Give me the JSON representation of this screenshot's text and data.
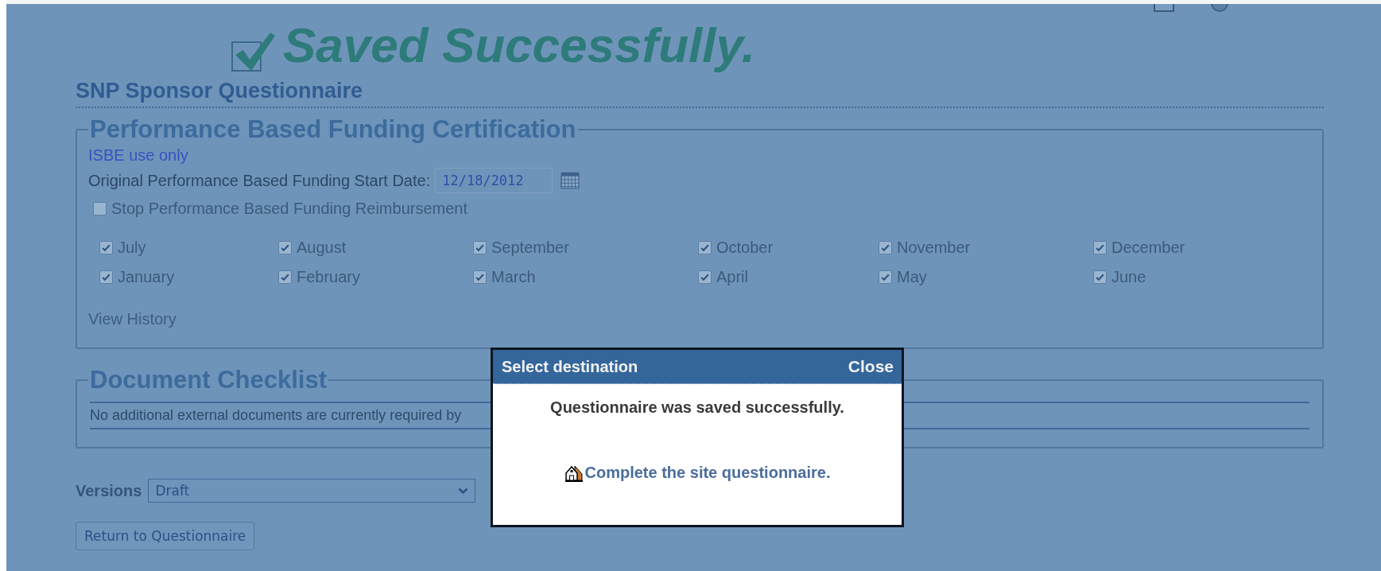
{
  "banner": {
    "text": "Saved Successfully."
  },
  "page_title": "SNP Sponsor Questionnaire",
  "certification": {
    "legend": "Performance Based Funding Certification",
    "note": "ISBE use only",
    "start_date": {
      "label": "Original Performance Based Funding Start Date:",
      "value": "12/18/2012"
    },
    "stop": {
      "label": "Stop Performance Based Funding Reimbursement",
      "checked": false,
      "disabled": true
    },
    "months": [
      {
        "label": "July",
        "checked": true,
        "disabled": true
      },
      {
        "label": "August",
        "checked": true,
        "disabled": true
      },
      {
        "label": "September",
        "checked": true,
        "disabled": true
      },
      {
        "label": "October",
        "checked": true,
        "disabled": true
      },
      {
        "label": "November",
        "checked": true,
        "disabled": true
      },
      {
        "label": "December",
        "checked": true,
        "disabled": true
      },
      {
        "label": "January",
        "checked": true,
        "disabled": true
      },
      {
        "label": "February",
        "checked": true,
        "disabled": true
      },
      {
        "label": "March",
        "checked": true,
        "disabled": true
      },
      {
        "label": "April",
        "checked": true,
        "disabled": true
      },
      {
        "label": "May",
        "checked": true,
        "disabled": true
      },
      {
        "label": "June",
        "checked": true,
        "disabled": true
      }
    ],
    "history_link": {
      "label": "View History",
      "disabled": true
    }
  },
  "checklist": {
    "legend": "Document Checklist",
    "message": "No additional external documents are currently required by"
  },
  "versions": {
    "label": "Versions",
    "value": "Draft"
  },
  "return_button": "Return to Questionnaire",
  "dialog": {
    "title": "Select destination",
    "close": "Close",
    "message": "Questionnaire was saved successfully.",
    "link": "Complete the site questionnaire."
  }
}
